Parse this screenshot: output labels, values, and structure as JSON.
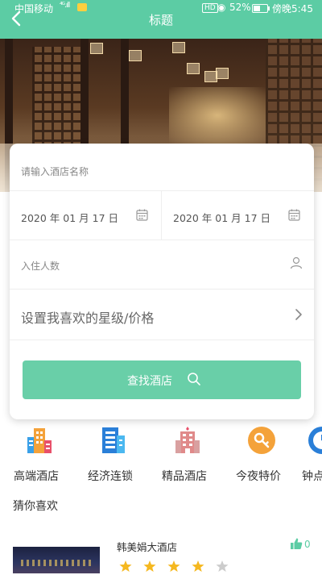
{
  "status_bar": {
    "carrier": "中国移动",
    "signal": "⁴ᴳ.ıll",
    "hd": "HD",
    "battery": "52%",
    "time": "傍晚5:45"
  },
  "header": {
    "title": "标题",
    "back_icon": "chevron-left-icon"
  },
  "search": {
    "hotel_name_placeholder": "请输入酒店名称",
    "checkin_date": "2020 年 01 月 17 日",
    "checkout_date": "2020 年 01 月 17 日",
    "guests_placeholder": "入住人数",
    "star_price_label": "设置我喜欢的星级/价格",
    "search_button": "查找酒店"
  },
  "categories": [
    {
      "label": "高端酒店",
      "icon": "building-icon"
    },
    {
      "label": "经济连锁",
      "icon": "office-icon"
    },
    {
      "label": "精品酒店",
      "icon": "boutique-hotel-icon"
    },
    {
      "label": "今夜特价",
      "icon": "key-icon"
    },
    {
      "label": "钟点房",
      "icon": "clock-icon"
    }
  ],
  "recommend": {
    "title": "猜你喜欢",
    "hotels": [
      {
        "name": "韩美娟大酒店",
        "rating": 4,
        "max_rating": 5,
        "likes": "0"
      }
    ]
  },
  "colors": {
    "accent": "#5ccca4",
    "button": "#69cfa8",
    "star_on": "#f5b820",
    "star_off": "#cccccc"
  }
}
